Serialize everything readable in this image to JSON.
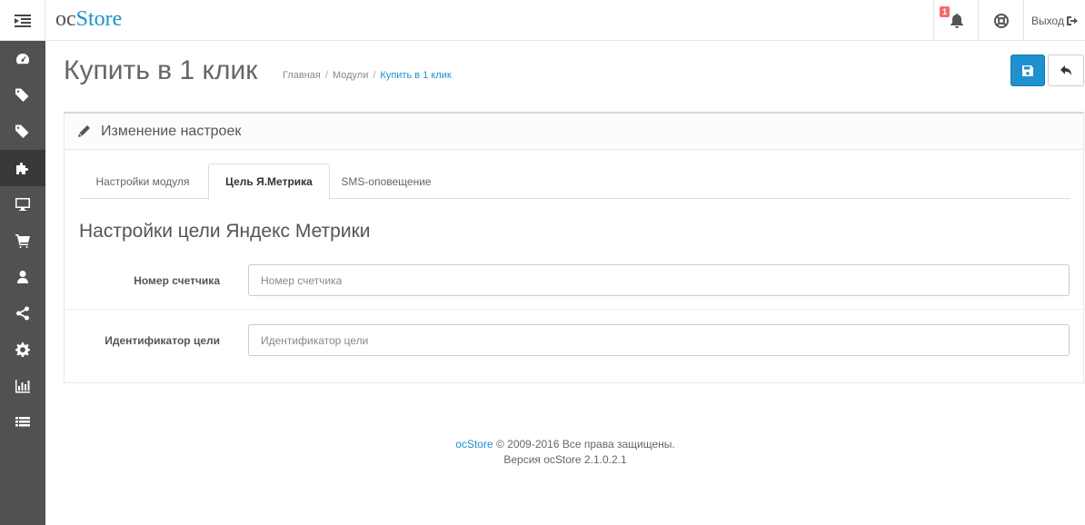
{
  "header": {
    "logo_oc": "oc",
    "logo_store": "Store",
    "notification_count": "1",
    "logout_label": "Выход"
  },
  "sidebar": {
    "items": [
      {
        "icon": "dashboard-icon",
        "active": false
      },
      {
        "icon": "tags-icon",
        "active": false
      },
      {
        "icon": "tags-icon",
        "active": false
      },
      {
        "icon": "puzzle-icon",
        "active": true
      },
      {
        "icon": "desktop-icon",
        "active": false
      },
      {
        "icon": "cart-icon",
        "active": false
      },
      {
        "icon": "user-icon",
        "active": false
      },
      {
        "icon": "share-icon",
        "active": false
      },
      {
        "icon": "cog-icon",
        "active": false
      },
      {
        "icon": "bar-chart-icon",
        "active": false
      },
      {
        "icon": "list-icon",
        "active": false
      }
    ]
  },
  "page": {
    "title": "Купить в 1 клик",
    "breadcrumb": [
      "Главная",
      "Модули",
      "Купить в 1 клик"
    ]
  },
  "panel": {
    "heading": "Изменение настроек",
    "tabs": [
      "Настройки модуля",
      "Цель Я.Метрика",
      "SMS-оповещение"
    ],
    "active_tab": "Цель Я.Метрика",
    "section_title": "Настройки цели Яндекс Метрики",
    "fields": [
      {
        "label": "Номер счетчика",
        "value": "",
        "placeholder": "Номер счетчика"
      },
      {
        "label": "Идентификатор цели",
        "value": "",
        "placeholder": "Идентификатор цели"
      }
    ]
  },
  "footer": {
    "brand": "ocStore",
    "copyright": "© 2009-2016 Все права защищены.",
    "version": "Версия ocStore 2.1.0.2.1"
  },
  "colors": {
    "accent": "#1e91cf",
    "sidebar_bg": "#515151",
    "sidebar_active": "#383838",
    "badge": "#f56b6b"
  }
}
